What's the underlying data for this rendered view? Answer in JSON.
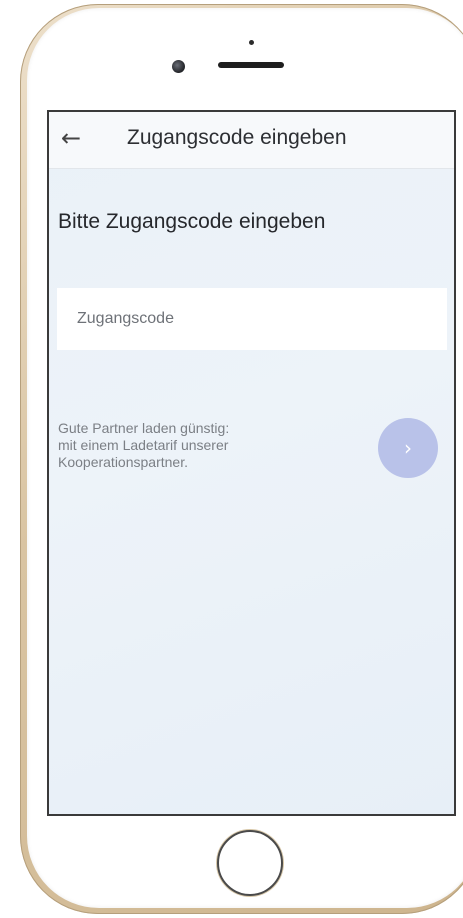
{
  "app_bar": {
    "back_icon": "arrow-left-icon",
    "back_glyph": "←",
    "title": "Zugangscode eingeben"
  },
  "main": {
    "heading": "Bitte Zugangscode eingeben",
    "code_input": {
      "value": "",
      "placeholder": "Zugangscode"
    },
    "hint_lines": [
      "Gute Partner laden günstig:",
      "mit einem Ladetarif unserer",
      "Kooperationspartner."
    ],
    "next_button": {
      "icon": "chevron-right-icon",
      "glyph": "›",
      "color": "#b9c2e9"
    }
  },
  "colors": {
    "screen_background": "#eaf1f8",
    "app_bar_background": "#f7f9fb",
    "frame_gold": "#d9c4a2"
  }
}
